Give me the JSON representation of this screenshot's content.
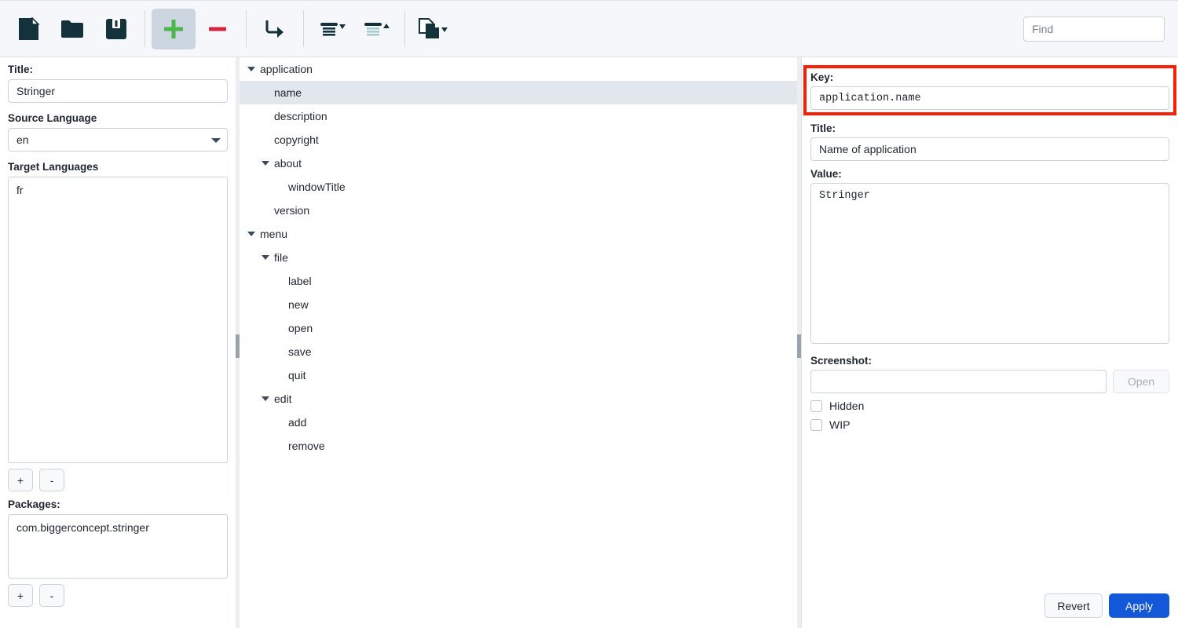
{
  "toolbar": {
    "buttons": [
      {
        "name": "new-file-button",
        "icon": "file-icon",
        "label": "New"
      },
      {
        "name": "open-folder-button",
        "icon": "folder-icon",
        "label": "Open"
      },
      {
        "name": "save-button",
        "icon": "floppy-disk-icon",
        "label": "Save"
      },
      {
        "name": "add-button",
        "icon": "plus-icon",
        "label": "Add",
        "active": true
      },
      {
        "name": "remove-button",
        "icon": "minus-icon",
        "label": "Remove"
      },
      {
        "name": "move-button",
        "icon": "arrow-turn-right-icon",
        "label": "Move"
      },
      {
        "name": "collapse-button",
        "icon": "collapse-list-icon",
        "label": "Collapse"
      },
      {
        "name": "expand-button",
        "icon": "expand-list-icon",
        "label": "Expand"
      },
      {
        "name": "copy-button",
        "icon": "copy-pages-icon",
        "label": "Copy"
      }
    ],
    "find_placeholder": "Find",
    "find_value": ""
  },
  "left": {
    "title_label": "Title:",
    "title_value": "Stringer",
    "source_language_label": "Source Language",
    "source_language_value": "en",
    "source_language_options": [
      "en"
    ],
    "target_languages_label": "Target Languages",
    "target_languages": [
      "fr"
    ],
    "packages_label": "Packages:",
    "packages": [
      "com.biggerconcept.stringer"
    ],
    "add_label": "+",
    "remove_label": "-"
  },
  "tree": {
    "nodes": [
      {
        "label": "application",
        "depth": 0,
        "expandable": true,
        "expanded": true,
        "selected": false
      },
      {
        "label": "name",
        "depth": 1,
        "expandable": false,
        "expanded": false,
        "selected": true
      },
      {
        "label": "description",
        "depth": 1,
        "expandable": false,
        "expanded": false,
        "selected": false
      },
      {
        "label": "copyright",
        "depth": 1,
        "expandable": false,
        "expanded": false,
        "selected": false
      },
      {
        "label": "about",
        "depth": 1,
        "expandable": true,
        "expanded": true,
        "selected": false
      },
      {
        "label": "windowTitle",
        "depth": 2,
        "expandable": false,
        "expanded": false,
        "selected": false
      },
      {
        "label": "version",
        "depth": 1,
        "expandable": false,
        "expanded": false,
        "selected": false
      },
      {
        "label": "menu",
        "depth": 0,
        "expandable": true,
        "expanded": true,
        "selected": false
      },
      {
        "label": "file",
        "depth": 1,
        "expandable": true,
        "expanded": true,
        "selected": false
      },
      {
        "label": "label",
        "depth": 2,
        "expandable": false,
        "expanded": false,
        "selected": false
      },
      {
        "label": "new",
        "depth": 2,
        "expandable": false,
        "expanded": false,
        "selected": false
      },
      {
        "label": "open",
        "depth": 2,
        "expandable": false,
        "expanded": false,
        "selected": false
      },
      {
        "label": "save",
        "depth": 2,
        "expandable": false,
        "expanded": false,
        "selected": false
      },
      {
        "label": "quit",
        "depth": 2,
        "expandable": false,
        "expanded": false,
        "selected": false
      },
      {
        "label": "edit",
        "depth": 1,
        "expandable": true,
        "expanded": true,
        "selected": false
      },
      {
        "label": "add",
        "depth": 2,
        "expandable": false,
        "expanded": false,
        "selected": false
      },
      {
        "label": "remove",
        "depth": 2,
        "expandable": false,
        "expanded": false,
        "selected": false
      }
    ]
  },
  "right": {
    "key_label": "Key:",
    "key_value": "application.name",
    "title_label": "Title:",
    "title_value": "Name of application",
    "value_label": "Value:",
    "value_value": "Stringer",
    "screenshot_label": "Screenshot:",
    "screenshot_value": "",
    "open_label": "Open",
    "hidden_label": "Hidden",
    "hidden_checked": false,
    "wip_label": "WIP",
    "wip_checked": false,
    "revert_label": "Revert",
    "apply_label": "Apply"
  },
  "colors": {
    "toolbar_bg": "#f5f7fa",
    "icon_dark": "#14323c",
    "plus_green": "#4cb64c",
    "minus_red": "#d5253f",
    "selection": "#e2e7ee",
    "accent_blue": "#1258d8",
    "annotation_red": "#f81f05"
  }
}
